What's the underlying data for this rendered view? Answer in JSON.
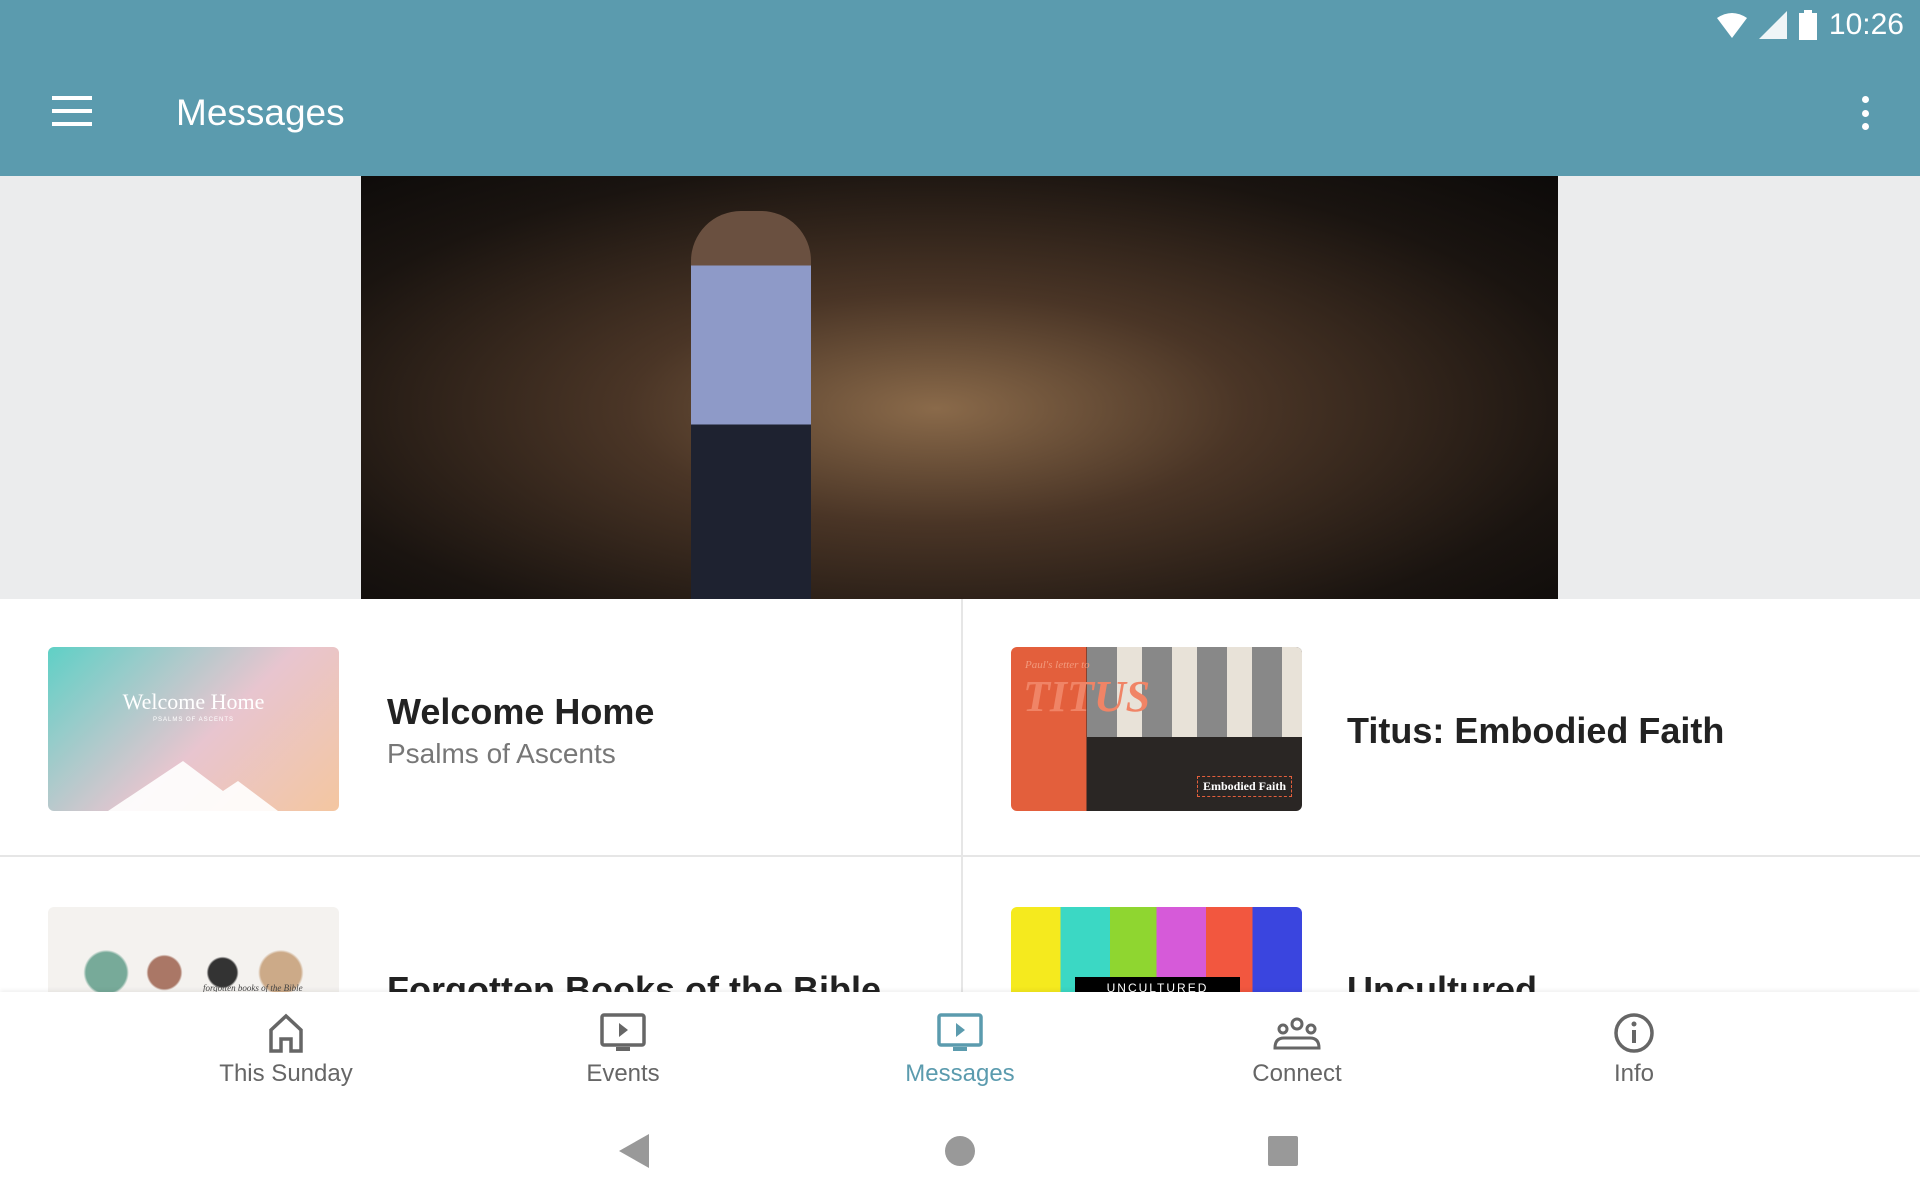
{
  "status_bar": {
    "time": "10:26",
    "icons": [
      "wifi-icon",
      "signal-icon",
      "battery-icon"
    ]
  },
  "app_bar": {
    "title": "Messages",
    "menu_icon": "hamburger-icon",
    "overflow_icon": "more-vert-icon"
  },
  "colors": {
    "primary": "#5b9bae"
  },
  "messages": [
    {
      "title": "Welcome Home",
      "subtitle": "Psalms of Ascents",
      "thumb_text": "Welcome Home",
      "thumb_sub": "PSALMS OF ASCENTS"
    },
    {
      "title": "Titus: Embodied Faith",
      "thumb_text": "TITUS",
      "thumb_pre": "Paul's letter to",
      "thumb_sub": "Embodied Faith"
    },
    {
      "title": "Forgotten Books of the Bible",
      "thumb_text": "forgotten books of the Bible"
    },
    {
      "title": "Uncultured",
      "thumb_text": "UNCULTURED"
    }
  ],
  "bottom_nav": [
    {
      "label": "This Sunday",
      "icon": "home-icon"
    },
    {
      "label": "Events",
      "icon": "tv-play-icon"
    },
    {
      "label": "Messages",
      "icon": "tv-play-icon",
      "active": true
    },
    {
      "label": "Connect",
      "icon": "group-icon"
    },
    {
      "label": "Info",
      "icon": "info-icon"
    }
  ]
}
